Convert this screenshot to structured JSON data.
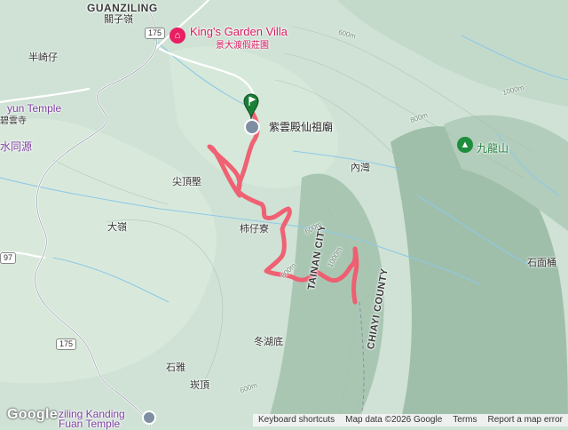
{
  "labels": {
    "guanziling_en": "GUANZILING",
    "guanziling_zh": "關子嶺",
    "hotel_en": "King's Garden Villa",
    "hotel_zh": "景大渡假莊園",
    "banqizai": "半崎仔",
    "temple_left_en": "yun Temple",
    "temple_left_zh": "碧雲寺",
    "shuiyuan": "水同源",
    "temple_main": "紫雲殿仙祖廟",
    "neiwan": "內灣",
    "jiulongshan": "九龍山",
    "jiandingqiao": "尖頂壂",
    "dalian": "大嶺",
    "shiziliao": "柿仔寮",
    "shimiantong": "石面桶",
    "donghudi": "冬湖底",
    "shiya": "石雅",
    "yanding": "崁頂",
    "kanding_temple": "ziling Kanding",
    "kanding_temple2": "Fuan Temple",
    "tainan_city": "TAINAN CITY",
    "chiayi_county": "CHIAYI COUNTY",
    "contour_600a": "600m",
    "contour_600b": "600m",
    "contour_800a": "800m",
    "contour_800b": "800m",
    "contour_1000a": "1000m",
    "contour_1000b": "1000m",
    "contour_600c": "600m"
  },
  "shields": {
    "r175_top": "175",
    "r175_bottom": "175",
    "r97": "97"
  },
  "footer": {
    "logo": "Google",
    "shortcuts": "Keyboard shortcuts",
    "map_data": "Map data ©2026 Google",
    "terms": "Terms",
    "report": "Report a map error"
  },
  "colors": {
    "route": "#f05a6e",
    "hotel_pin": "#e91e63",
    "peak_pin": "#1e8e3e",
    "start_pin": "#1a7f37"
  }
}
